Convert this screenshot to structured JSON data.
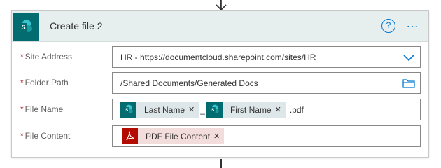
{
  "card": {
    "title": "Create file 2",
    "help_label": "?",
    "more_label": "…"
  },
  "fields": {
    "site_address": {
      "label": "Site Address",
      "value": "HR - https://documentcloud.sharepoint.com/sites/HR"
    },
    "folder_path": {
      "label": "Folder Path",
      "value": "/Shared Documents/Generated Docs"
    },
    "file_name": {
      "label": "File Name",
      "token1": "Last Name",
      "separator": "_",
      "token2": "First Name",
      "suffix": ".pdf"
    },
    "file_content": {
      "label": "File Content",
      "token": "PDF File Content"
    }
  },
  "required_marker": "*",
  "remove_glyph": "✕",
  "colors": {
    "header_bg": "#e6eeee",
    "sharepoint_teal": "#036c70",
    "accent_blue": "#0078d4",
    "required_red": "#a4262c",
    "pdf_red": "#b30b00"
  },
  "icons": {
    "connector": "arrow-down-icon",
    "header": "sharepoint-icon",
    "site_dropdown": "chevron-down-icon",
    "folder_picker": "folder-icon",
    "pdf": "adobe-pdf-icon"
  }
}
